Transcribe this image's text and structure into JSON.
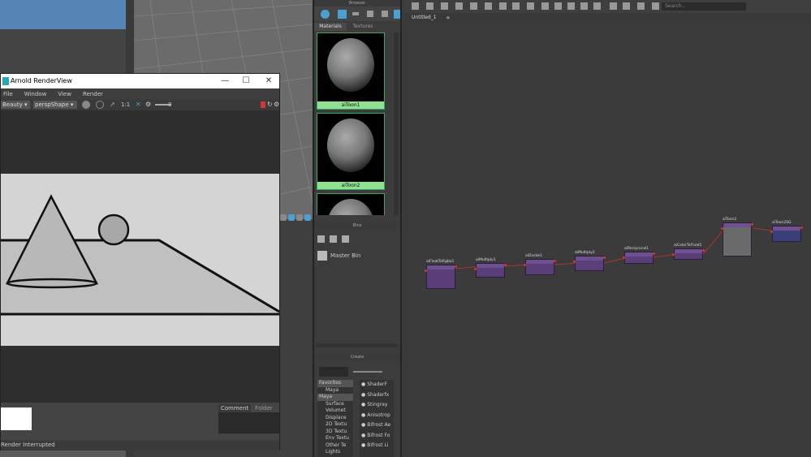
{
  "render_view": {
    "title": "Arnold RenderView",
    "menu": [
      "File",
      "Window",
      "View",
      "Render"
    ],
    "aov": "Beauty",
    "camera": "perspShape",
    "zoom_label": "1:1",
    "exposure": "0",
    "comment_tab": "Comment",
    "folder_tab": "Folder",
    "status": "Render Interrupted"
  },
  "browser": {
    "title": "Browser",
    "tabs": [
      "Materials",
      "Textures"
    ],
    "swatches": [
      "aiToon1",
      "aiToon2"
    ]
  },
  "bins": {
    "title": "Bins",
    "master_bin": "Master Bin"
  },
  "create": {
    "title": "Create",
    "tree": [
      {
        "label": "Favorites",
        "header": true
      },
      {
        "label": "Maya",
        "header": false
      },
      {
        "label": "Maya",
        "header": true
      },
      {
        "label": "Surface",
        "header": false
      },
      {
        "label": "Volumet",
        "header": false
      },
      {
        "label": "Displace",
        "header": false
      },
      {
        "label": "2D Textu",
        "header": false
      },
      {
        "label": "3D Textu",
        "header": false
      },
      {
        "label": "Env Textu",
        "header": false
      },
      {
        "label": "Other Te",
        "header": false
      },
      {
        "label": "Lights",
        "header": false
      }
    ],
    "nodes": [
      "ShaderF",
      "Shaderfx",
      "Stingray",
      "Anisotrop",
      "Bifrost Ae",
      "Bifrost Fo",
      "Bifrost Li"
    ]
  },
  "node_editor": {
    "tab": "Untitled_1",
    "search_placeholder": "Search...",
    "nodes": [
      {
        "name": "aiFloatToRgba1"
      },
      {
        "name": "aiMultiply1"
      },
      {
        "name": "aiDivide1"
      },
      {
        "name": "aiMultiply2"
      },
      {
        "name": "aiReciprocal1"
      },
      {
        "name": "aiColorToFloat1"
      },
      {
        "name": "aiToon2"
      },
      {
        "name": "aiToon2SG"
      }
    ]
  }
}
